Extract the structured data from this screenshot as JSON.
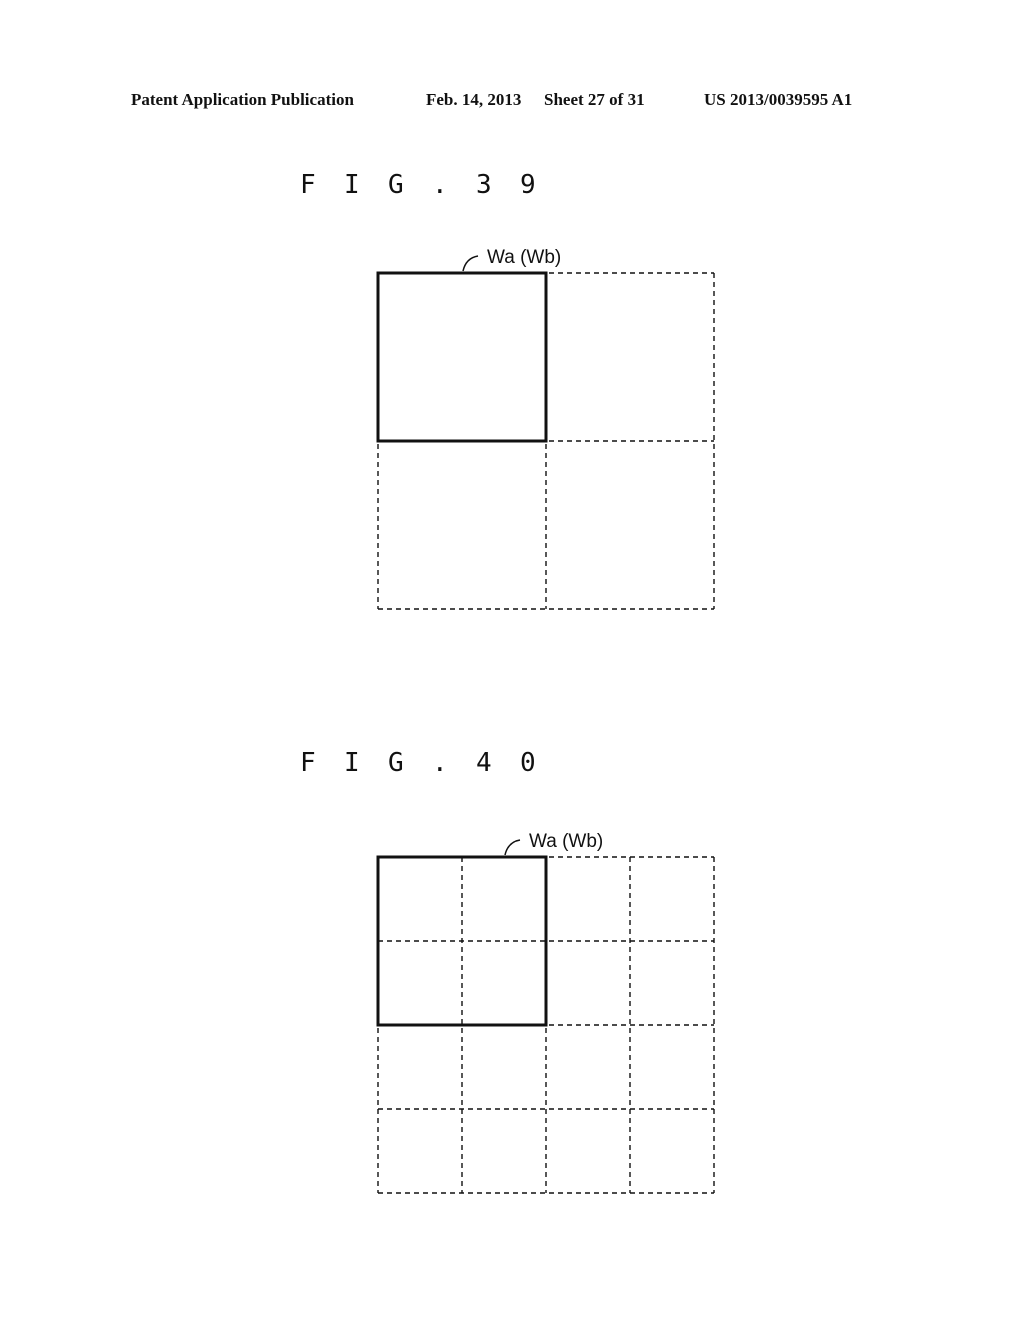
{
  "header": {
    "publication": "Patent Application Publication",
    "date": "Feb. 14, 2013",
    "sheet": "Sheet 27 of 31",
    "number": "US 2013/0039595 A1"
  },
  "figures": [
    {
      "id": "fig39",
      "title_chars": [
        "F",
        "I",
        "G",
        ".",
        "3",
        "9"
      ],
      "label": "Wa (Wb)",
      "grid": {
        "rows": 2,
        "cols": 2
      },
      "highlight": {
        "rows": 1,
        "cols": 1
      }
    },
    {
      "id": "fig40",
      "title_chars": [
        "F",
        "I",
        "G",
        ".",
        "4",
        "0"
      ],
      "label": "Wa (Wb)",
      "grid": {
        "rows": 4,
        "cols": 4
      },
      "highlight": {
        "rows": 2,
        "cols": 2
      }
    }
  ]
}
